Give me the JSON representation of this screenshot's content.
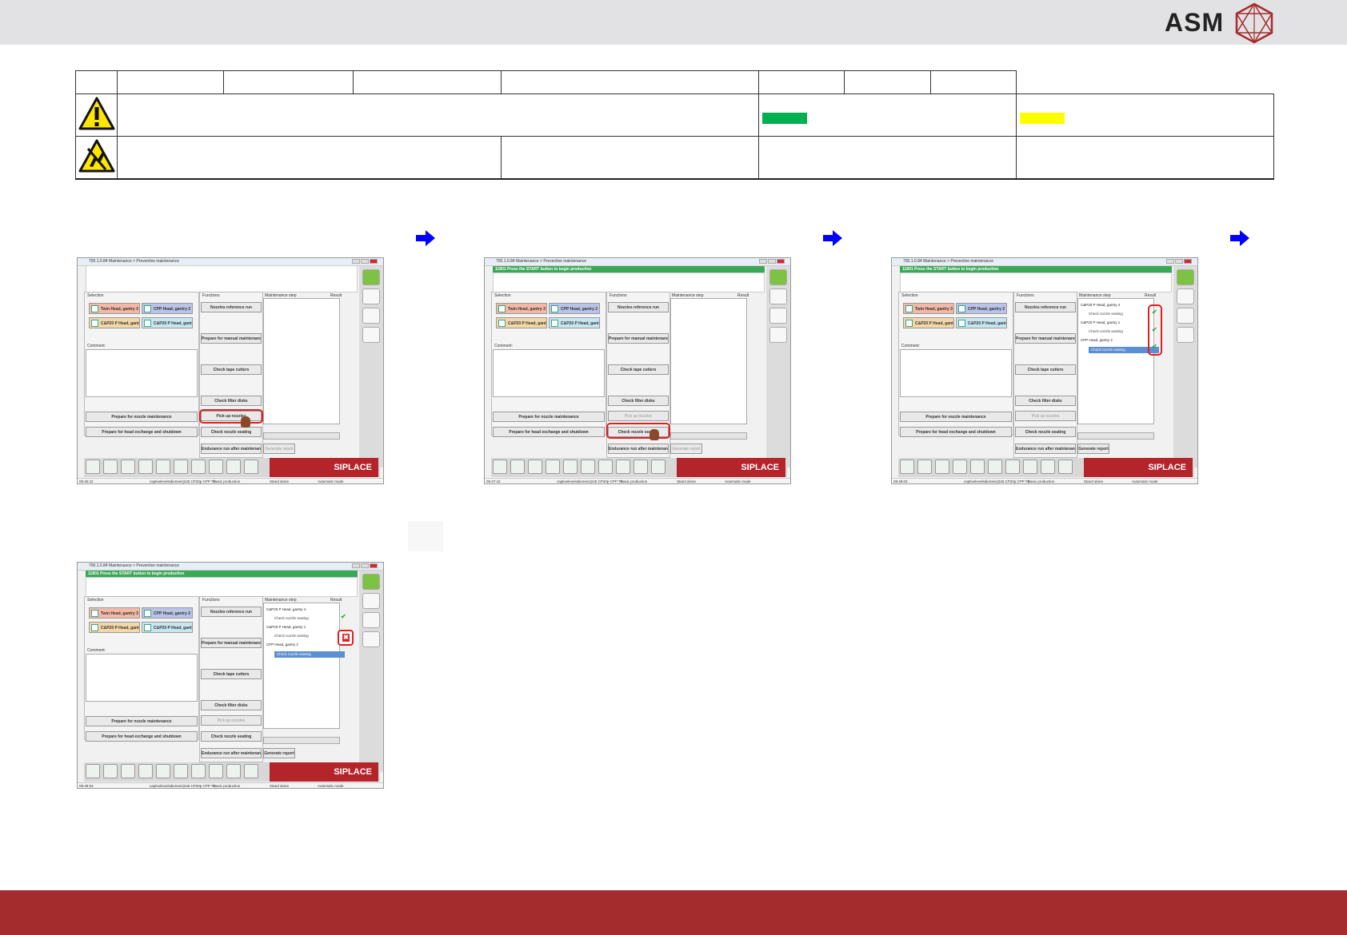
{
  "header": {
    "logo_text": "ASM",
    "brand_color": "#a52c2c"
  },
  "header_table": {
    "caution_icon": "warning-triangle-icon",
    "esd_icon": "esd-warning-icon",
    "status_colors": [
      "#00b050",
      "#ffff00"
    ]
  },
  "arrows": {
    "icon": "arrow-right-icon",
    "color": "#0000ff"
  },
  "screens": [
    {
      "title": "700.1.0.84 Maintenance > Preventive maintenance",
      "status_bar": "",
      "steps": [],
      "selection_label": "Selection",
      "functions_label": "Functions",
      "maintenance_label": "Maintenance step",
      "result_label": "Result",
      "comment_label": "Comment:",
      "heads": [
        "Twin Head, gantry 3",
        "CPP Head, gantry 2",
        "C&P20 P Head, gantry 4",
        "C&P20 P Head, gantry 1"
      ],
      "functions": [
        "Nozzles reference run",
        "Prepare for manual maintenance",
        "Check tape cutters",
        "Check filter disks",
        "Pick up nozzles",
        "Check nozzle seating",
        "Endurance run after maintenance",
        "Generate report"
      ],
      "left_buttons": [
        "Prepare for nozzle maintenance",
        "Prepare for head exchange and shutdown"
      ],
      "brand": "SIPLACE",
      "footer": [
        "09:46:42",
        "captivelevelsdiensen|245 CP20p CPP Tk",
        "Basic production",
        "Stand alone",
        "Automatic mode"
      ]
    },
    {
      "title": "700.1.0.84 Maintenance > Preventive maintenance",
      "status_bar": "11901 Press the START button to begin production",
      "steps": [],
      "selection_label": "Selection",
      "functions_label": "Functions",
      "maintenance_label": "Maintenance step",
      "result_label": "Result",
      "comment_label": "Comment:",
      "heads": [
        "Twin Head, gantry 3",
        "CPP Head, gantry 2",
        "C&P20 P Head, gantry 4",
        "C&P20 P Head, gantry 1"
      ],
      "functions": [
        "Nozzles reference run",
        "Prepare for manual maintenance",
        "Check tape cutters",
        "Check filter disks",
        "Pick up nozzles",
        "Check nozzle seating",
        "Endurance run after maintenance",
        "Generate report"
      ],
      "left_buttons": [
        "Prepare for nozzle maintenance",
        "Prepare for head exchange and shutdown"
      ],
      "brand": "SIPLACE",
      "footer": [
        "09:47:42",
        "captivelevelsdiensen|245 CP20p CPP Tk",
        "Basic production",
        "Stand alone",
        "Automatic mode"
      ]
    },
    {
      "title": "700.1.0.84 Maintenance > Preventive maintenance",
      "status_bar": "11901 Press the START button to begin production",
      "steps": [
        {
          "label": "C&P20 P Head, gantry 4",
          "sub": false
        },
        {
          "label": "Check nozzle seating",
          "sub": true
        },
        {
          "label": "C&P20 P Head, gantry 1",
          "sub": false
        },
        {
          "label": "Check nozzle seating",
          "sub": true
        },
        {
          "label": "CPP Head, gantry 2",
          "sub": false
        },
        {
          "label": "Check nozzle seating",
          "sub": true
        }
      ],
      "selection_label": "Selection",
      "functions_label": "Functions",
      "maintenance_label": "Maintenance step",
      "result_label": "Result",
      "comment_label": "Comment:",
      "heads": [
        "Twin Head, gantry 3",
        "CPP Head, gantry 2",
        "C&P20 P Head, gantry 4",
        "C&P20 P Head, gantry 1"
      ],
      "functions": [
        "Nozzles reference run",
        "Prepare for manual maintenance",
        "Check tape cutters",
        "Check filter disks",
        "Pick up nozzles",
        "Check nozzle seating",
        "Endurance run after maintenance",
        "Generate report"
      ],
      "left_buttons": [
        "Prepare for nozzle maintenance",
        "Prepare for head exchange and shutdown"
      ],
      "brand": "SIPLACE",
      "footer": [
        "09:48:03",
        "captivelevelsdiensen|245 CP20p CPP Tk",
        "Basic production",
        "Stand alone",
        "Automatic mode"
      ]
    },
    {
      "title": "700.1.0.84 Maintenance > Preventive maintenance",
      "status_bar": "11901 Press the START button to begin production",
      "steps": [
        {
          "label": "C&P20 P Head, gantry 4",
          "sub": false
        },
        {
          "label": "Check nozzle seating",
          "sub": true
        },
        {
          "label": "C&P20 P Head, gantry 1",
          "sub": false
        },
        {
          "label": "Check nozzle seating",
          "sub": true
        },
        {
          "label": "CPP Head, gantry 2",
          "sub": false
        },
        {
          "label": "Check nozzle seating",
          "sub": true
        }
      ],
      "selection_label": "Selection",
      "functions_label": "Functions",
      "maintenance_label": "Maintenance step",
      "result_label": "Result",
      "comment_label": "Comment:",
      "heads": [
        "Twin Head, gantry 3",
        "CPP Head, gantry 2",
        "C&P20 P Head, gantry 4",
        "C&P20 P Head, gantry 1"
      ],
      "functions": [
        "Nozzles reference run",
        "Prepare for manual maintenance",
        "Check tape cutters",
        "Check filter disks",
        "Pick up nozzles",
        "Check nozzle seating",
        "Endurance run after maintenance",
        "Generate report"
      ],
      "left_buttons": [
        "Prepare for nozzle maintenance",
        "Prepare for head exchange and shutdown"
      ],
      "brand": "SIPLACE",
      "footer": [
        "09:48:53",
        "captivelevelsdiensen|245 CP20p CPP Tk",
        "Basic production",
        "Stand alone",
        "Automatic mode"
      ]
    }
  ]
}
